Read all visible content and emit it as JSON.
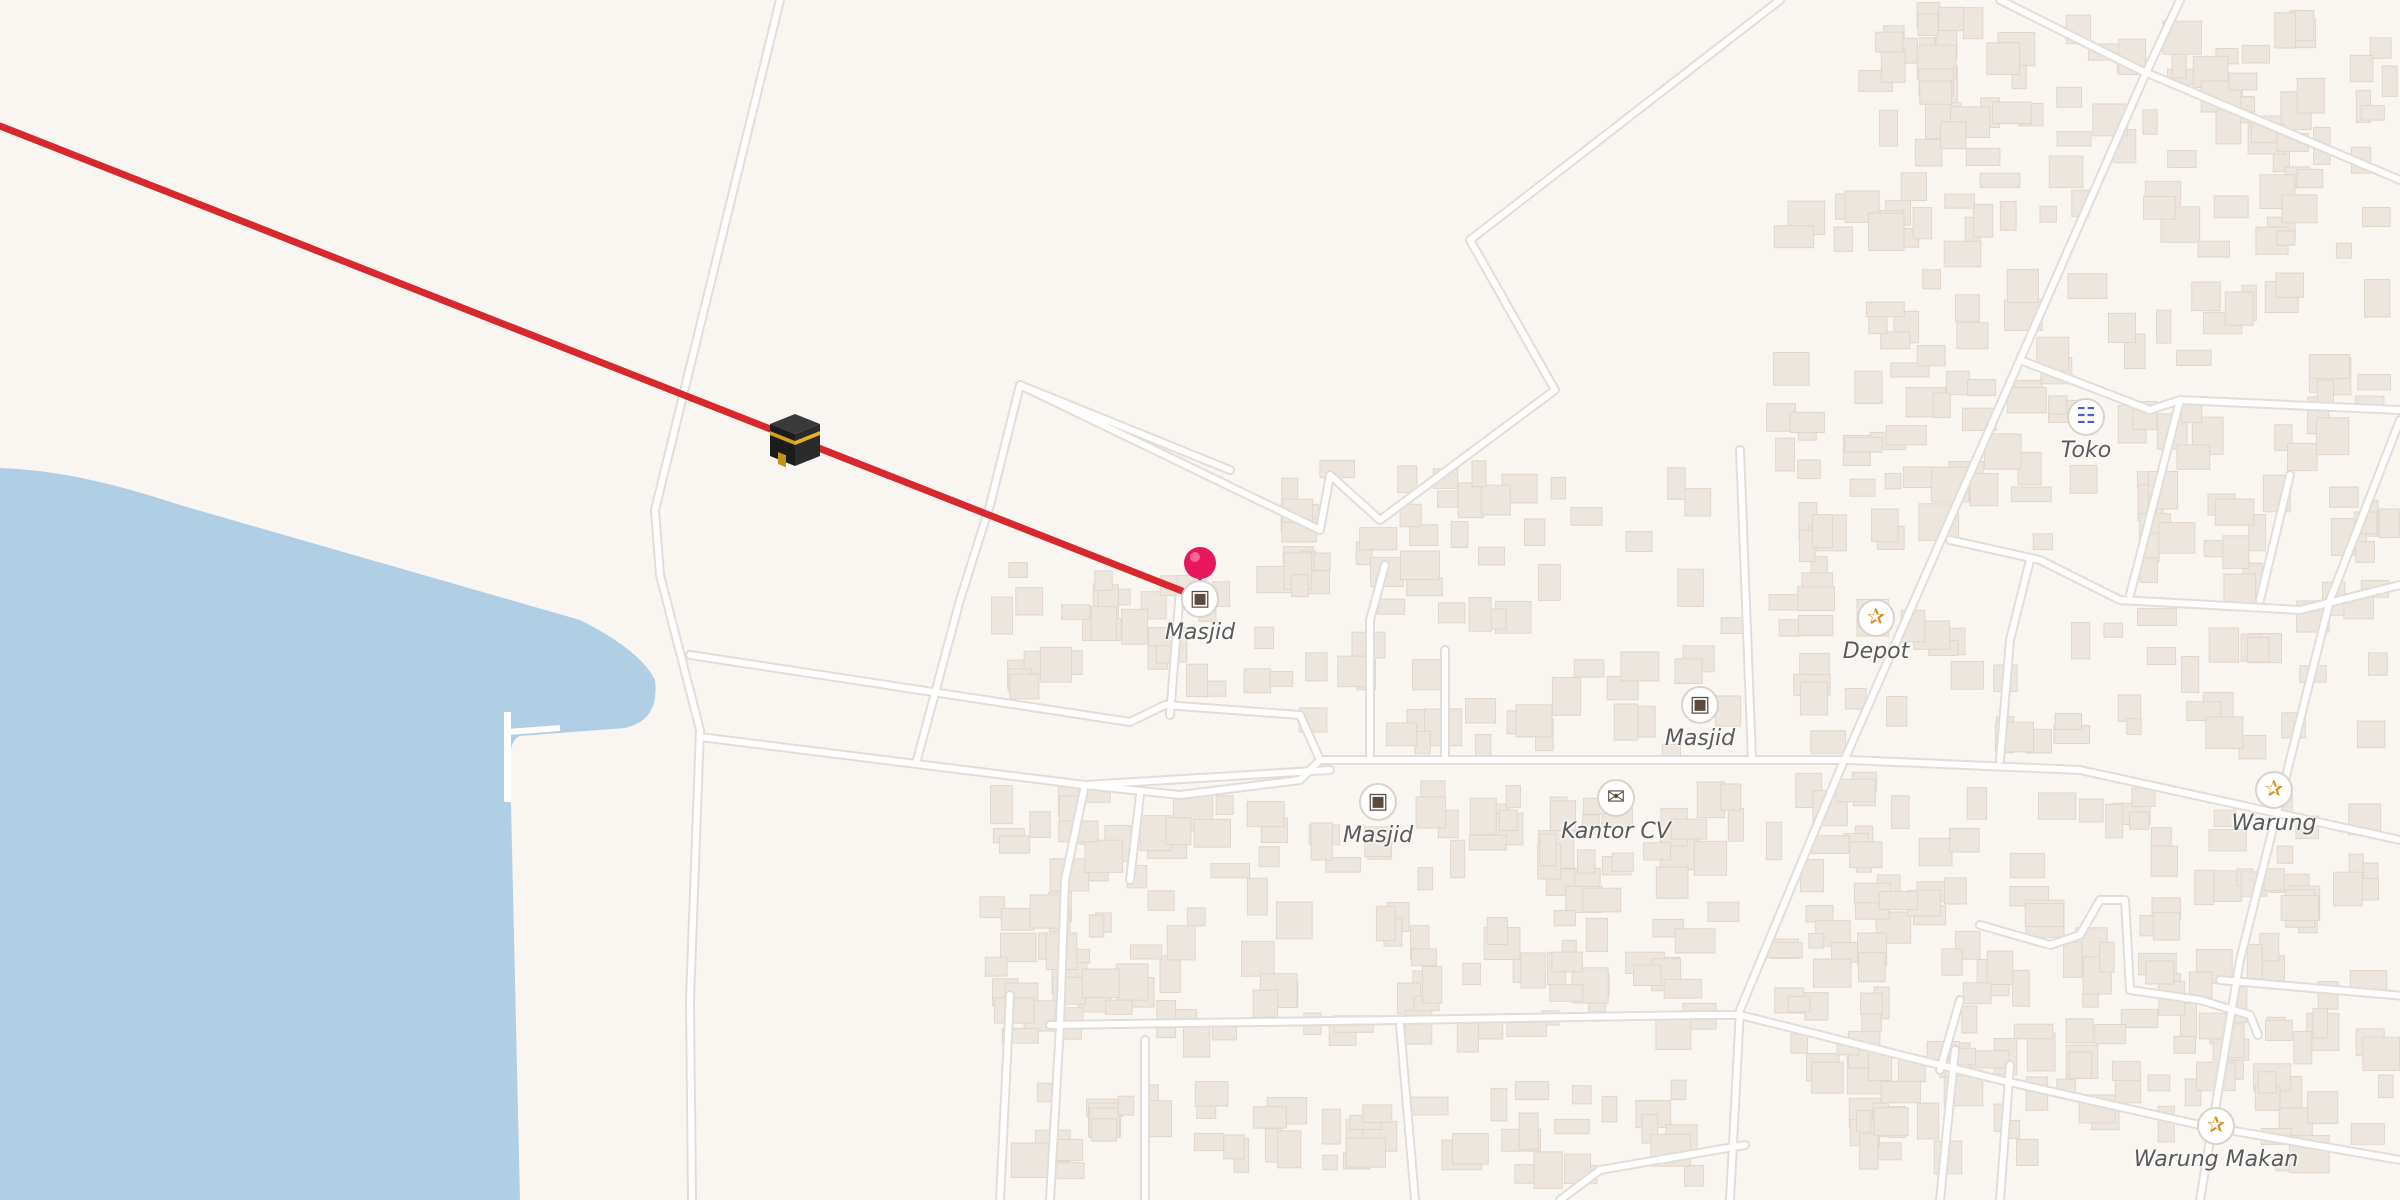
{
  "map": {
    "colors": {
      "land": "#f9f6f2",
      "water": "#b0cfe5",
      "road": "#ffffff",
      "road_casing": "#e2ddd6",
      "building": "#ede6df",
      "building_edge": "#e0d7cd",
      "qibla_line": "#d7282e",
      "pin": "#e8175d"
    },
    "icons": {
      "kaaba": "kaaba-icon",
      "pin": "location-pin-icon",
      "mosque": "mosque-icon",
      "food": "fork-knife-icon",
      "shop": "cart-icon",
      "mail": "envelope-icon"
    }
  },
  "poi": [
    {
      "label": "Masjid",
      "icon": "mosque-icon",
      "color": "#5a4a3f"
    },
    {
      "label": "Masjid",
      "icon": "mosque-icon",
      "color": "#5a4a3f"
    },
    {
      "label": "Masjid",
      "icon": "mosque-icon",
      "color": "#5a4a3f"
    },
    {
      "label": "Kantor CV",
      "icon": "envelope-icon",
      "color": "#5a4a3f"
    },
    {
      "label": "Depot",
      "icon": "fork-knife-icon",
      "color": "#d98c14"
    },
    {
      "label": "Toko",
      "icon": "cart-icon",
      "color": "#4a5bd4"
    },
    {
      "label": "Warung",
      "icon": "fork-knife-icon",
      "color": "#d98c14"
    },
    {
      "label": "Warung Makan",
      "icon": "fork-knife-icon",
      "color": "#d98c14"
    }
  ]
}
